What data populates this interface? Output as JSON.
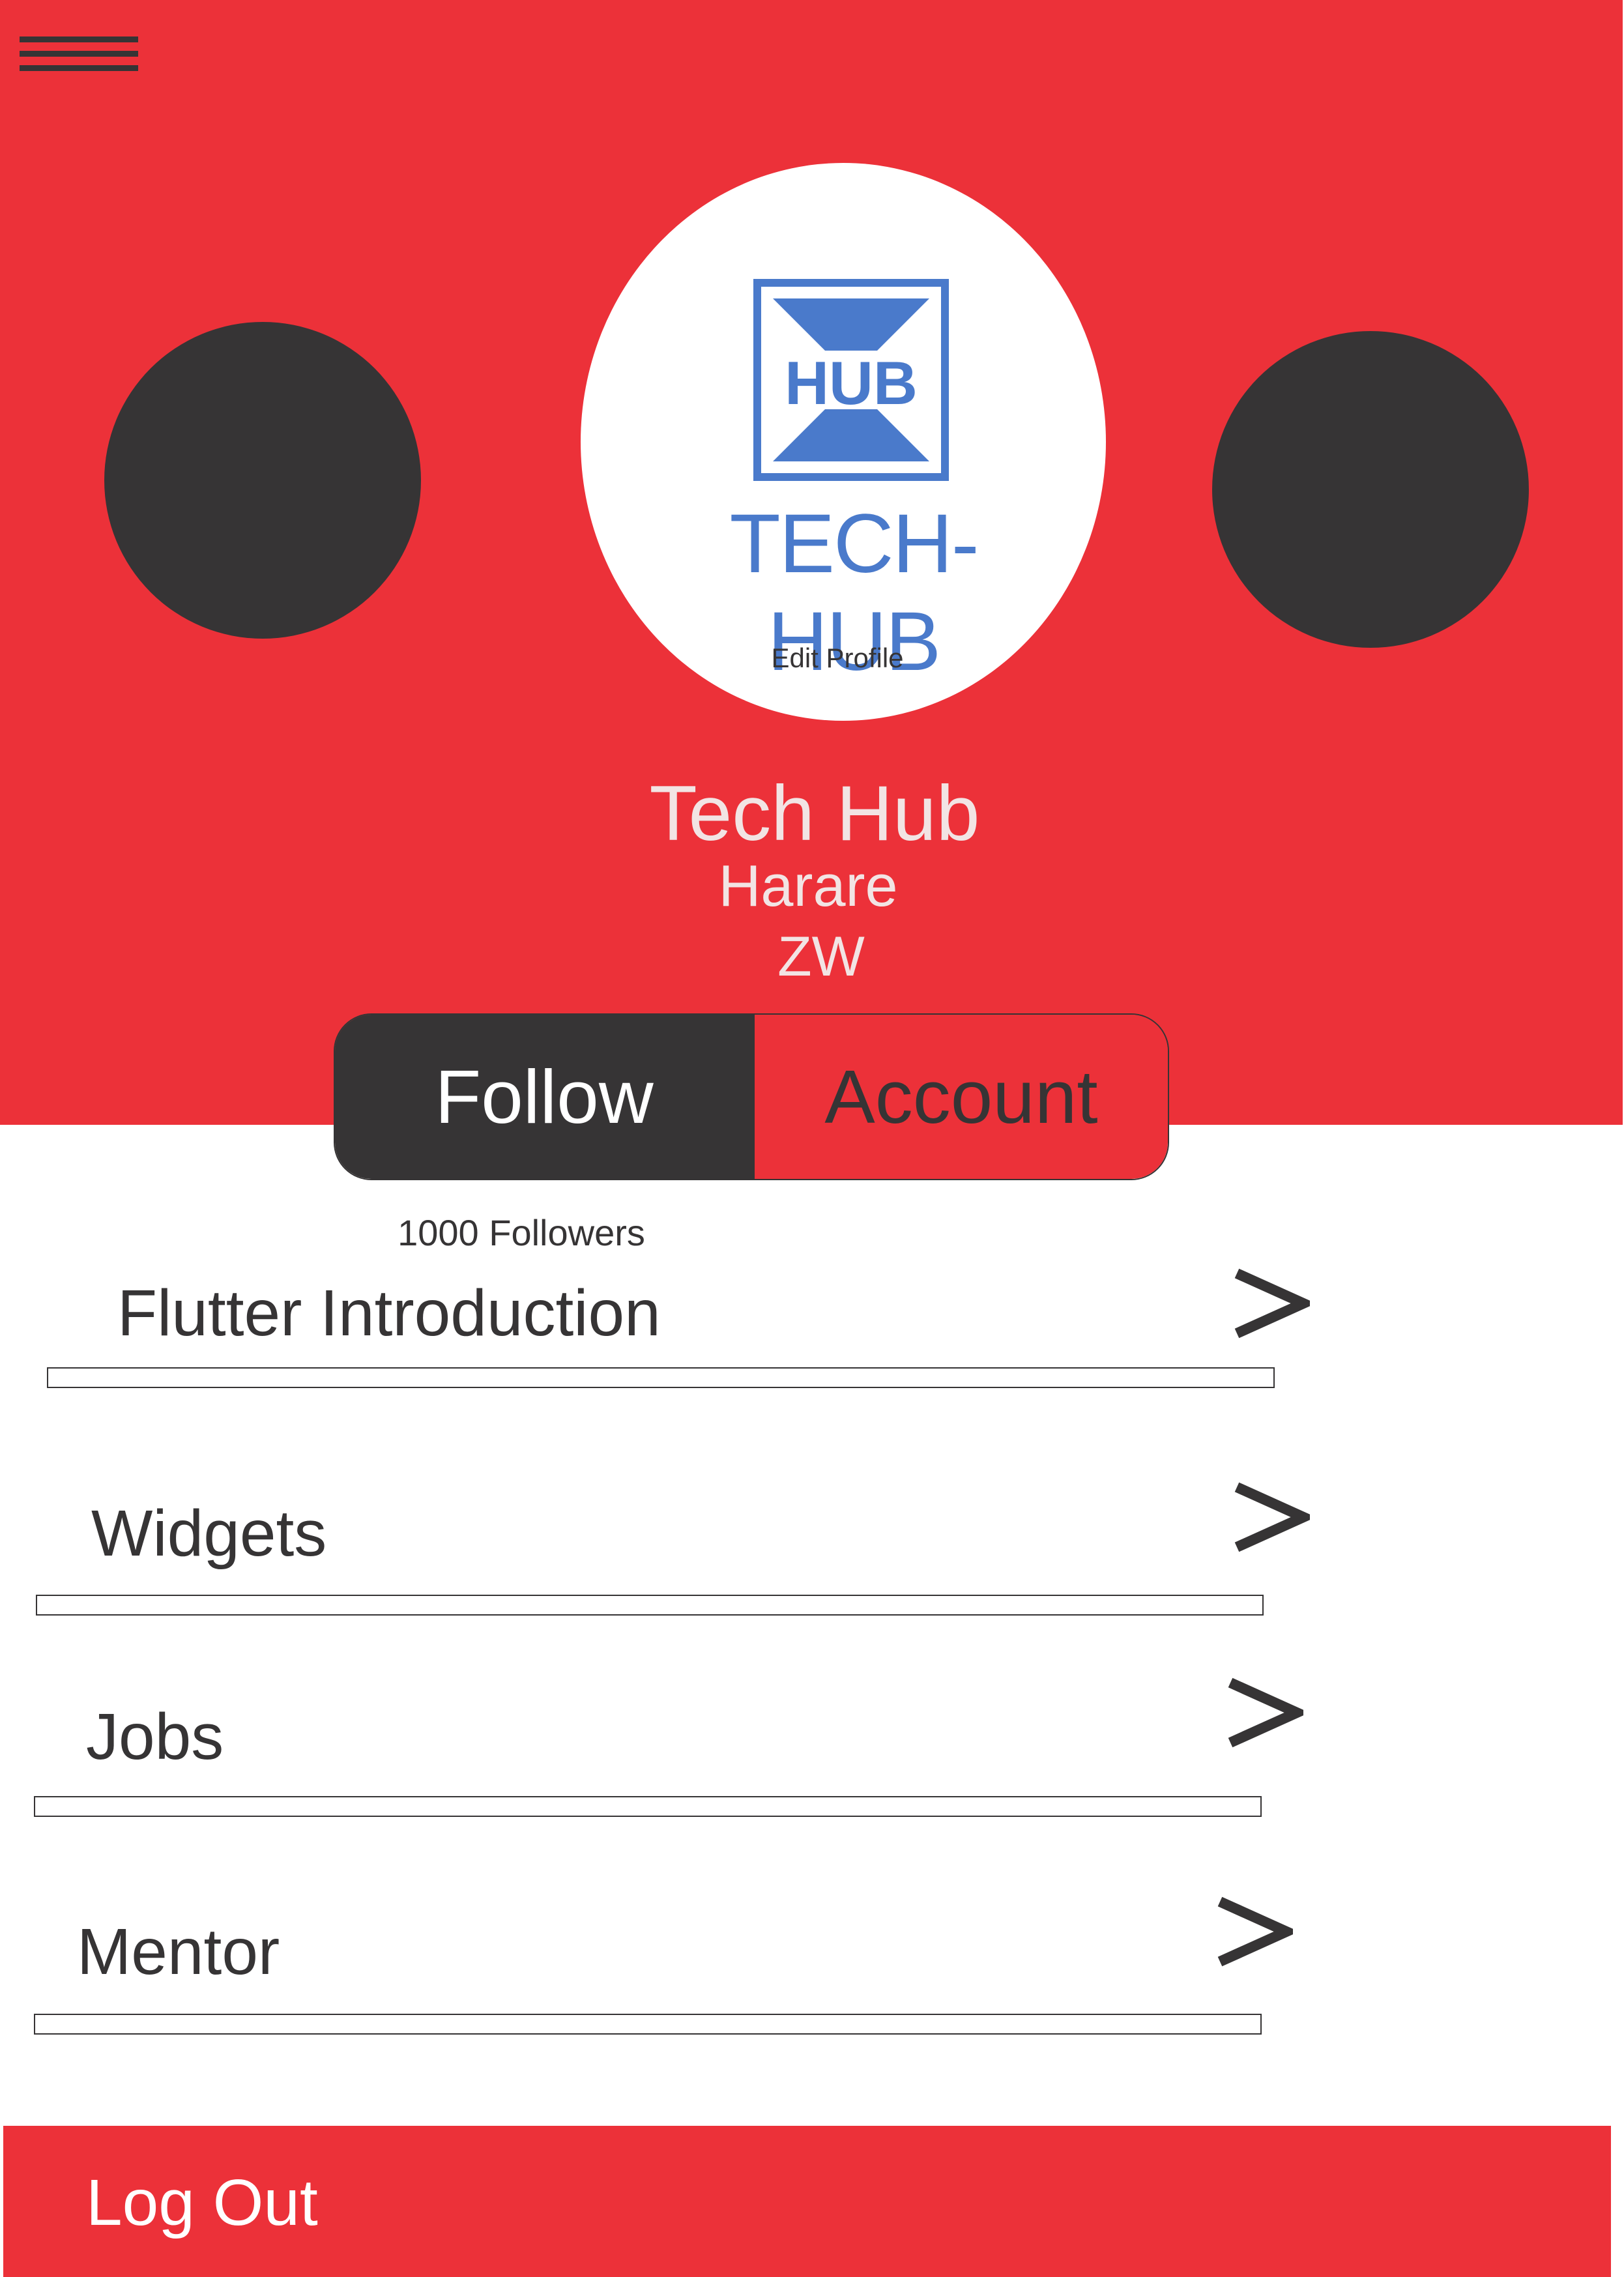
{
  "colors": {
    "brand_red": "#ec3139",
    "dark": "#363435",
    "logo_blue": "#4a7acb",
    "light_text": "#f2e4e4"
  },
  "header": {
    "menu_icon": "hamburger-menu-icon"
  },
  "profile": {
    "logo_badge": "HUB",
    "logo_text": "TECH-HUB",
    "edit_label": "Edit Profile",
    "name": "Tech Hub",
    "city": "Harare",
    "country": "ZW"
  },
  "actions": {
    "follow_label": "Follow",
    "account_label": "Account"
  },
  "stats": {
    "followers": "1000 Followers"
  },
  "menu": {
    "items": [
      {
        "label": "Flutter Introduction",
        "icon": "chevron-right-icon"
      },
      {
        "label": "Widgets",
        "icon": "chevron-right-icon"
      },
      {
        "label": "Jobs",
        "icon": "chevron-right-icon"
      },
      {
        "label": "Mentor",
        "icon": "chevron-right-icon"
      }
    ]
  },
  "footer": {
    "logout_label": "Log Out"
  }
}
